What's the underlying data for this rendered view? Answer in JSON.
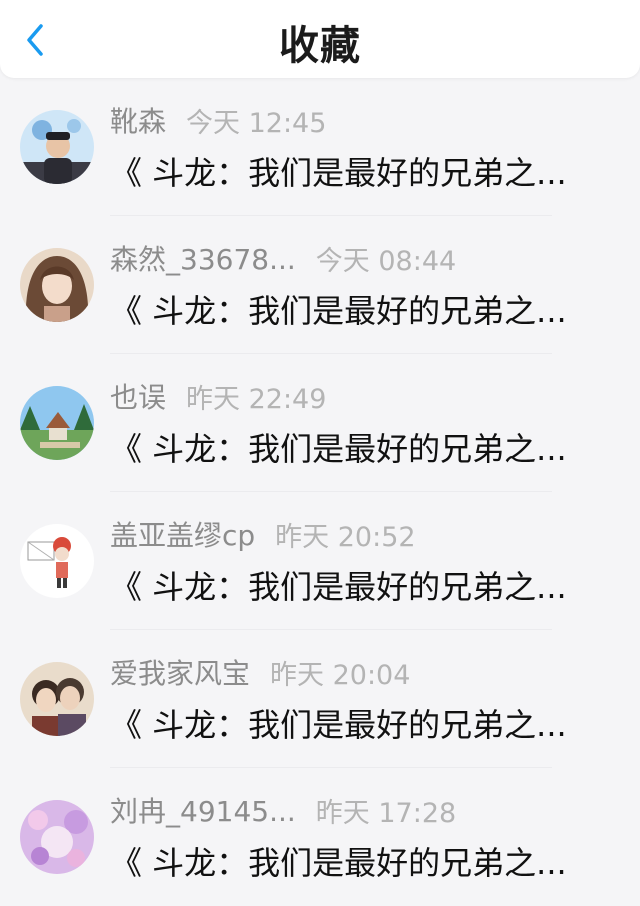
{
  "header": {
    "title": "收藏",
    "back_icon": "chevron-left-icon",
    "accent_color": "#1a9bf0"
  },
  "items": [
    {
      "name": "靴森",
      "time": "今天 12:45",
      "text": "《 斗龙：我们是最好的兄弟之..."
    },
    {
      "name": "森然_33678...",
      "time": "今天 08:44",
      "text": "《 斗龙：我们是最好的兄弟之..."
    },
    {
      "name": "也误",
      "time": "昨天 22:49",
      "text": "《 斗龙：我们是最好的兄弟之..."
    },
    {
      "name": "盖亚盖缪cp",
      "time": "昨天 20:52",
      "text": "《 斗龙：我们是最好的兄弟之..."
    },
    {
      "name": "爱我家风宝",
      "time": "昨天 20:04",
      "text": "《 斗龙：我们是最好的兄弟之..."
    },
    {
      "name": "刘冉_49145...",
      "time": "昨天 17:28",
      "text": "《 斗龙：我们是最好的兄弟之..."
    }
  ]
}
